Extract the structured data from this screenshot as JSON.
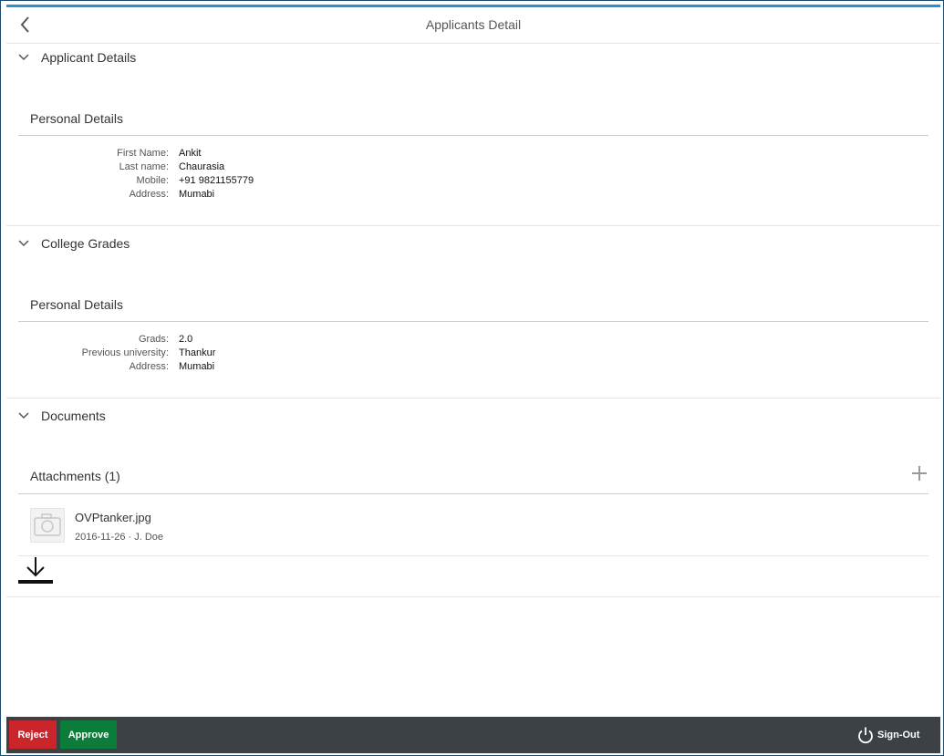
{
  "header": {
    "title": "Applicants Detail",
    "back_icon": "chevron-left-icon"
  },
  "sections": [
    {
      "title": "Applicant Details",
      "group_title": "Personal Details",
      "fields": [
        {
          "label": "First Name",
          "value": "Ankit"
        },
        {
          "label": "Last name",
          "value": "Chaurasia"
        },
        {
          "label": "Mobile",
          "value": "+91 9821155779"
        },
        {
          "label": "Address",
          "value": "Mumabi"
        }
      ]
    },
    {
      "title": "College Grades",
      "group_title": "Personal Details",
      "fields": [
        {
          "label": "Grads",
          "value": "2.0"
        },
        {
          "label": "Previous university",
          "value": "Thankur"
        },
        {
          "label": "Address",
          "value": "Mumabi"
        }
      ]
    },
    {
      "title": "Documents",
      "group_title": "Attachments (1)",
      "attachments": [
        {
          "file_name": "OVPtanker.jpg",
          "meta": "2016-11-26 · J. Doe",
          "thumb_icon": "camera-icon"
        }
      ]
    }
  ],
  "footer": {
    "reject_label": "Reject",
    "approve_label": "Approve",
    "signout_label": "Sign-Out"
  },
  "colors": {
    "accent": "#2b8fd6",
    "reject": "#c9252b",
    "approve": "#0b7c3a",
    "footer_bg": "#3b4145"
  }
}
